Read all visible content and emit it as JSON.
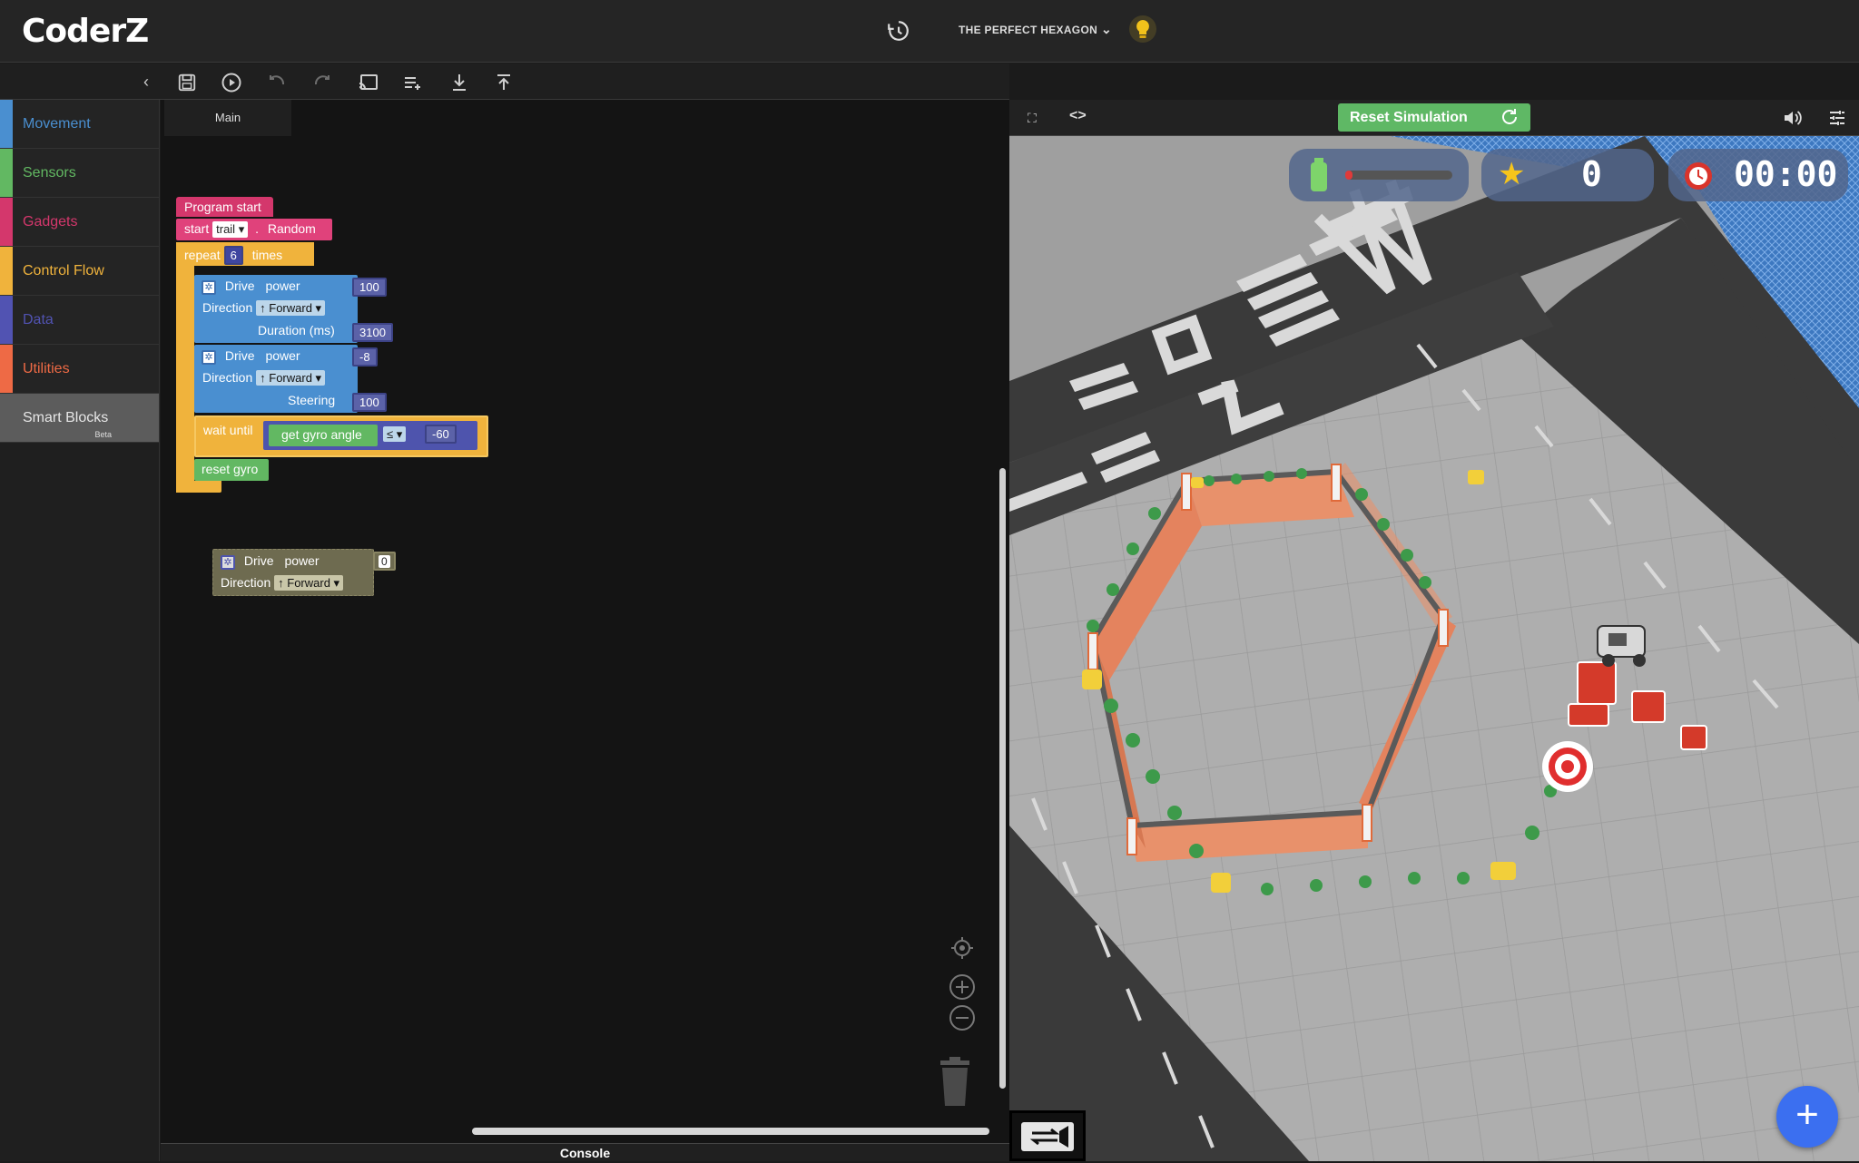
{
  "app": {
    "logo_text": "CoderZ",
    "mission_title": "THE PERFECT HEXAGON"
  },
  "sidebar": {
    "items": [
      {
        "label": "Movement",
        "color": "#4a8fd0"
      },
      {
        "label": "Sensors",
        "color": "#62b862"
      },
      {
        "label": "Gadgets",
        "color": "#d4376c"
      },
      {
        "label": "Control Flow",
        "color": "#f0b33c"
      },
      {
        "label": "Data",
        "color": "#5153b2"
      },
      {
        "label": "Utilities",
        "color": "#ee6a45"
      },
      {
        "label": "Smart Blocks",
        "color": "#5c5c5c",
        "badge": "Beta"
      }
    ]
  },
  "toolbar": {
    "icons": [
      "save-icon",
      "play-icon",
      "undo-icon",
      "redo-icon",
      "cast-icon",
      "add-list-icon",
      "download-icon",
      "upload-icon"
    ]
  },
  "workspace": {
    "tab_label": "Main",
    "console_label": "Console",
    "blocks": {
      "program_start": "Program start",
      "start": "start",
      "trail_option": "trail",
      "random": "Random",
      "repeat": "repeat",
      "repeat_count": "6",
      "times": "times",
      "drive": "Drive",
      "power": "power",
      "direction": "Direction",
      "forward": "↑ Forward",
      "duration": "Duration (ms)",
      "steering": "Steering",
      "drive1_power": "100",
      "drive1_duration": "3100",
      "drive2_power": "-8",
      "drive2_steering": "100",
      "wait_until": "wait until",
      "get_gyro_angle": "get gyro angle",
      "operator": "≤",
      "gyro_target": "-60",
      "reset_gyro": "reset gyro",
      "loose_power": "0"
    }
  },
  "simulation": {
    "reset_label": "Reset Simulation",
    "stars": "0",
    "timer": "00:00"
  },
  "colors": {
    "accent_green": "#5fb865",
    "movement_blue": "#4a8fd0",
    "control_orange": "#f0b33c",
    "program_pink": "#d4376c",
    "fab_blue": "#3b6ff0"
  }
}
